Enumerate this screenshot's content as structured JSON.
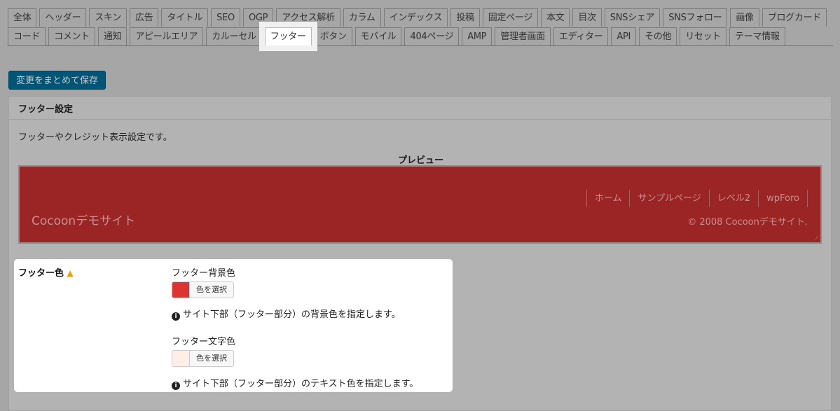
{
  "tabs": [
    "全体",
    "ヘッダー",
    "スキン",
    "広告",
    "タイトル",
    "SEO",
    "OGP",
    "アクセス解析",
    "カラム",
    "インデックス",
    "投稿",
    "固定ページ",
    "本文",
    "目次",
    "SNSシェア",
    "SNSフォロー",
    "画像",
    "ブログカード",
    "コード",
    "コメント",
    "通知",
    "アピールエリア",
    "カルーセル",
    "フッター",
    "ボタン",
    "モバイル",
    "404ページ",
    "AMP",
    "管理者画面",
    "エディター",
    "API",
    "その他",
    "リセット",
    "テーマ情報"
  ],
  "active_tab": "フッター",
  "save_label": "変更をまとめて保存",
  "panel": {
    "title": "フッター設定",
    "description": "フッターやクレジット表示設定です。",
    "preview_label": "プレビュー",
    "preview": {
      "site_name": "Cocoonデモサイト",
      "nav": [
        "ホーム",
        "サンプルページ",
        "レベル2",
        "wpForo"
      ],
      "copyright": "© 2008 Cocoonデモサイト.",
      "bg_color": "#9b2424"
    }
  },
  "footer_color": {
    "label": "フッター色",
    "warning_icon": "warning-icon",
    "bg": {
      "label": "フッター背景色",
      "color": "#dd3333",
      "button": "色を選択",
      "help": "サイト下部（フッター部分）の背景色を指定します。"
    },
    "text": {
      "label": "フッター文字色",
      "color": "#ffeee8",
      "button": "色を選択",
      "help": "サイト下部（フッター部分）のテキスト色を指定します。"
    }
  }
}
